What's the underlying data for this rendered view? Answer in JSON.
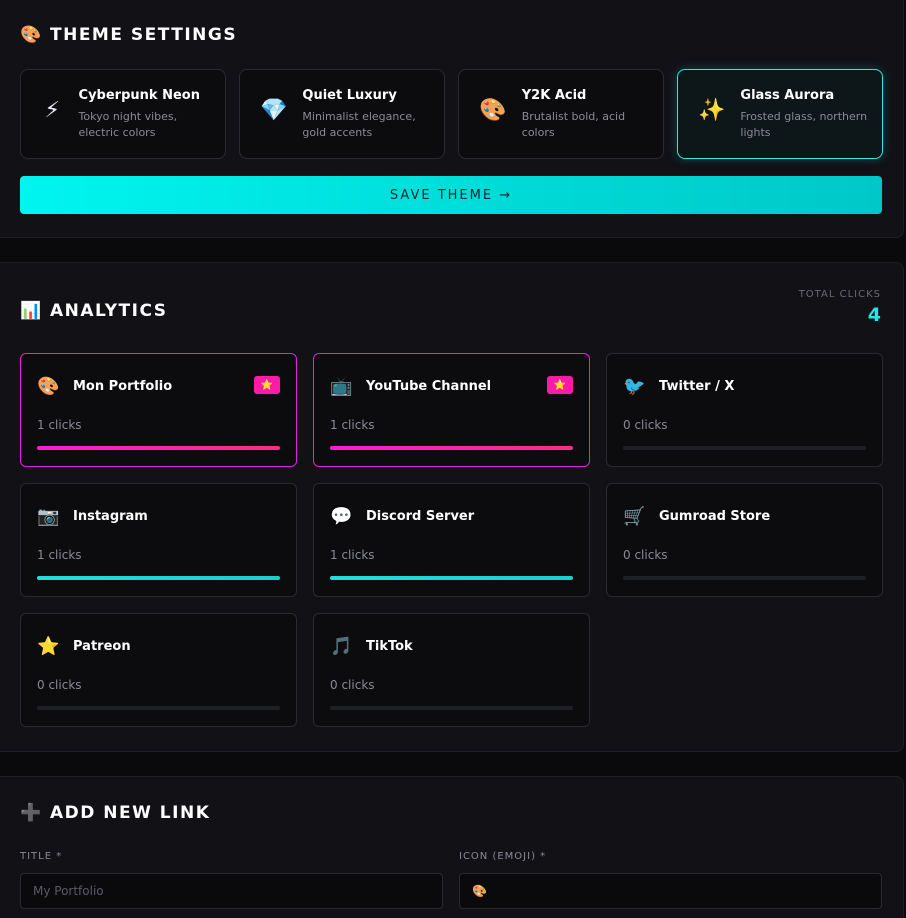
{
  "theme": {
    "title": "THEME SETTINGS",
    "title_icon": "🎨",
    "save_label": "SAVE THEME →",
    "cards": [
      {
        "icon": "⚡",
        "name": "Cyberpunk Neon",
        "desc": "Tokyo night vibes, electric colors",
        "active": false
      },
      {
        "icon": "💎",
        "name": "Quiet Luxury",
        "desc": "Minimalist elegance, gold accents",
        "active": false
      },
      {
        "icon": "🎨",
        "name": "Y2K Acid",
        "desc": "Brutalist bold, acid colors",
        "active": false
      },
      {
        "icon": "✨",
        "name": "Glass Aurora",
        "desc": "Frosted glass, northern lights",
        "active": true
      }
    ]
  },
  "analytics": {
    "title": "ANALYTICS",
    "title_icon": "📊",
    "total_label": "TOTAL CLICKS",
    "total_value": "4",
    "links": [
      {
        "icon": "🎨",
        "name": "Mon Portfolio",
        "clicks": "1 clicks",
        "share": 1.0,
        "top": true,
        "color": "pink"
      },
      {
        "icon": "📺",
        "name": "YouTube Channel",
        "clicks": "1 clicks",
        "share": 1.0,
        "top": true,
        "color": "pink"
      },
      {
        "icon": "🐦",
        "name": "Twitter / X",
        "clicks": "0 clicks",
        "share": 0,
        "top": false,
        "color": "none"
      },
      {
        "icon": "📷",
        "name": "Instagram",
        "clicks": "1 clicks",
        "share": 1.0,
        "top": false,
        "color": "cyan"
      },
      {
        "icon": "💬",
        "name": "Discord Server",
        "clicks": "1 clicks",
        "share": 1.0,
        "top": false,
        "color": "cyan"
      },
      {
        "icon": "🛒",
        "name": "Gumroad Store",
        "clicks": "0 clicks",
        "share": 0,
        "top": false,
        "color": "none"
      },
      {
        "icon": "⭐",
        "name": "Patreon",
        "clicks": "0 clicks",
        "share": 0,
        "top": false,
        "color": "none"
      },
      {
        "icon": "🎵",
        "name": "TikTok",
        "clicks": "0 clicks",
        "share": 0,
        "top": false,
        "color": "none"
      }
    ],
    "badge_icon": "⭐"
  },
  "add_link": {
    "title": "ADD NEW LINK",
    "title_icon": "➕",
    "title_field_label": "TITLE *",
    "title_field_placeholder": "My Portfolio",
    "icon_field_label": "ICON (EMOJI) *",
    "icon_field_value": "🎨"
  },
  "colors": {
    "accent_cyan": "#00f0ee",
    "accent_pink": "#ff1ad6",
    "background": "#0a0a0d"
  }
}
